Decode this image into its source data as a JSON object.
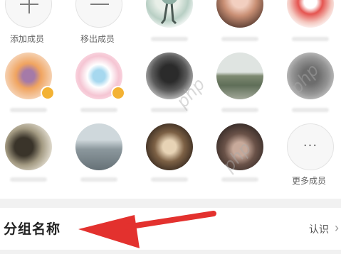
{
  "members_panel": {
    "add_member_label": "添加成员",
    "remove_member_label": "移出成员",
    "more_members_label": "更多成员",
    "more_members_icon": "···",
    "watermark_text": "php"
  },
  "group_row": {
    "title": "分组名称",
    "value": "认识",
    "chevron": "›"
  },
  "annotation": {
    "arrow_color": "#e3312e"
  }
}
